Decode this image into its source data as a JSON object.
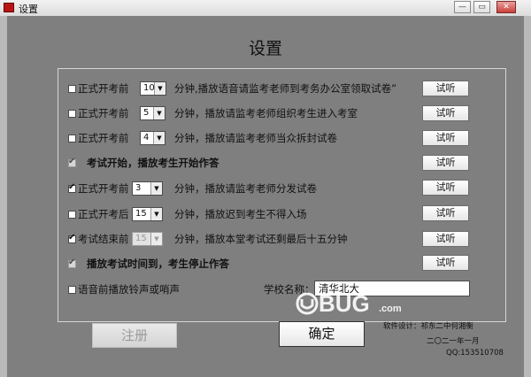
{
  "window": {
    "title": "设置",
    "minimize_glyph": "—",
    "maximize_glyph": "▭",
    "close_glyph": "✕"
  },
  "dialog": {
    "title": "设置"
  },
  "rows": [
    {
      "label": "正式开考前",
      "checked": false,
      "select_value": "10",
      "desc": "分钟,播放语音请监考老师到考务办公室领取试卷”",
      "listen": "试听"
    },
    {
      "label": "正式开考前",
      "checked": false,
      "select_value": "5",
      "desc": "分钟，播放请监考老师组织考生进入考室",
      "listen": "试听"
    },
    {
      "label": "正式开考前",
      "checked": false,
      "select_value": "4",
      "desc": "分钟，播放请监考老师当众拆封试卷",
      "listen": "试听"
    },
    {
      "label": "考试开始，播放考生开始作答",
      "checked": true,
      "listen": "试听"
    },
    {
      "label": "正式开考前",
      "checked": true,
      "select_value": "3",
      "desc": "分钟，播放请监考老师分发试卷",
      "listen": "试听"
    },
    {
      "label": "正式开考后",
      "checked": false,
      "select_value": "15",
      "desc": "分钟，播放迟到考生不得入场",
      "listen": "试听"
    },
    {
      "label": "考试结束前",
      "checked": true,
      "select_value": "15",
      "desc": "分钟，播放本堂考试还剩最后十五分钟",
      "listen": "试听"
    },
    {
      "label": "播放考试时间到，考生停止作答",
      "checked": true,
      "listen": "试听"
    }
  ],
  "ring_option": {
    "label": "语音前播放铃声或哨声",
    "checked": false
  },
  "school": {
    "label": "学校名称：",
    "value": "清华北大"
  },
  "buttons": {
    "register": "注册",
    "ok": "确定"
  },
  "footer": {
    "design": "软件设计：祁东二中何湘衡",
    "date": "二〇二一年一月",
    "qq": "QQ:153510708"
  },
  "watermark": {
    "text": "UEBUG",
    "suffix": ".com",
    "color": "#ffffff"
  }
}
